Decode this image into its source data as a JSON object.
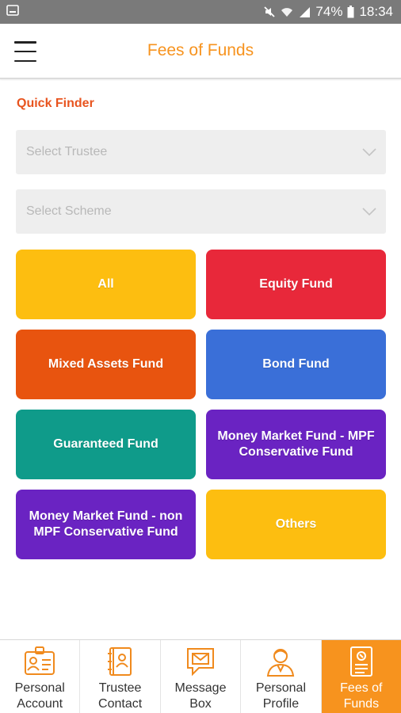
{
  "status_bar": {
    "battery": "74%",
    "time": "18:34"
  },
  "header": {
    "title": "Fees of Funds",
    "menu_icon": "hamburger-menu-icon"
  },
  "quick_finder": {
    "label": "Quick Finder",
    "trustee_placeholder": "Select Trustee",
    "scheme_placeholder": "Select Scheme"
  },
  "fund_buttons": [
    {
      "label": "All",
      "color": "#fdbe10"
    },
    {
      "label": "Equity Fund",
      "color": "#e8283a"
    },
    {
      "label": "Mixed Assets Fund",
      "color": "#e8540f"
    },
    {
      "label": "Bond Fund",
      "color": "#3a6fd8"
    },
    {
      "label": "Guaranteed Fund",
      "color": "#0f9b8a"
    },
    {
      "label": "Money Market Fund - MPF Conservative Fund",
      "color": "#6a23c2"
    },
    {
      "label": "Money Market Fund - non MPF Conservative Fund",
      "color": "#6a23c2"
    },
    {
      "label": "Others",
      "color": "#fdbe10"
    }
  ],
  "bottom_nav": [
    {
      "label1": "Personal",
      "label2": "Account",
      "icon": "id-card-icon",
      "active": false
    },
    {
      "label1": "Trustee",
      "label2": "Contact",
      "icon": "contact-book-icon",
      "active": false
    },
    {
      "label1": "Message",
      "label2": "Box",
      "icon": "message-envelope-icon",
      "active": false
    },
    {
      "label1": "Personal",
      "label2": "Profile",
      "icon": "user-profile-icon",
      "active": false
    },
    {
      "label1": "Fees of",
      "label2": "Funds",
      "icon": "fees-document-icon",
      "active": true
    }
  ],
  "colors": {
    "accent": "#f7931e",
    "quick_finder": "#e8541f",
    "icon_orange": "#f08a1d"
  }
}
